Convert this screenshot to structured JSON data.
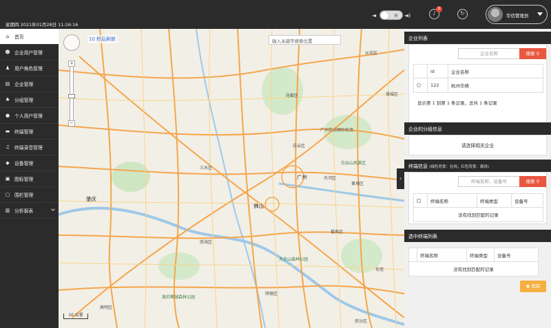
{
  "header": {
    "datetime": "星期四 2021年01月28日 11:26:16",
    "toggle_label": "关",
    "notification_count": "0",
    "username": "华信管理员"
  },
  "sidebar": {
    "items": [
      {
        "label": "首页",
        "icon": "home-icon"
      },
      {
        "label": "企业用户管理",
        "icon": "users-icon"
      },
      {
        "label": "用户角色管理",
        "icon": "user-role-icon"
      },
      {
        "label": "企业管理",
        "icon": "building-icon"
      },
      {
        "label": "分组管理",
        "icon": "sitemap-icon"
      },
      {
        "label": "个人用户管理",
        "icon": "user-icon"
      },
      {
        "label": "终端管理",
        "icon": "terminal-icon"
      },
      {
        "label": "终端录音管理",
        "icon": "music-icon"
      },
      {
        "label": "设备管理",
        "icon": "tag-icon"
      },
      {
        "label": "图标管理",
        "icon": "image-icon"
      },
      {
        "label": "围栏管理",
        "icon": "fence-icon"
      },
      {
        "label": "分析报表",
        "icon": "report-icon"
      }
    ]
  },
  "map": {
    "refresh_text": "10 秒后刷新",
    "search_placeholder": "输入关键字搜索位置",
    "scale_text": "10 公里",
    "labels": {
      "guangzhou": "广州",
      "foshan": "佛山",
      "zhaoqing": "肇庆",
      "baiyun": "白云区",
      "tianhe": "天河区",
      "huangpu": "黄埔区",
      "panyu": "番禺区",
      "nanhai": "南海区",
      "shunde": "顺德区",
      "conghua": "从化区",
      "zengcheng": "增城区",
      "dongguan": "东莞",
      "sanshui": "三水区",
      "huadu": "花都区",
      "airport": "广州白云国际机场",
      "nansha": "南沙区",
      "gaoming": "高明区",
      "park1": "白云山风景区",
      "park2": "大夫山森林公园",
      "park3": "美的鹭湖森林公园"
    }
  },
  "enterprise_list": {
    "title": "企业列表",
    "search_placeholder": "企业名称",
    "search_button": "搜索",
    "columns": [
      "id",
      "企业名称"
    ],
    "rows": [
      {
        "id": "122",
        "name": "杭州华络"
      }
    ],
    "page_info": "显示第 1 到第 1 条记录，总共 1 条记录"
  },
  "group_info": {
    "title": "企业的分组信息",
    "message": "请选择相关企业"
  },
  "terminal_info": {
    "title": "终端信息",
    "subtitle": "(绿色背景：在线；红色背景：离线)",
    "search_placeholder": "终端名称、设备号",
    "search_button": "搜索",
    "columns": [
      "终端名称",
      "终端类型",
      "设备号"
    ],
    "empty": "没有找到匹配的记录"
  },
  "selected_list": {
    "title": "选中终端列表",
    "columns": [
      "终端名称",
      "终端类型",
      "设备号"
    ],
    "empty": "没有找到匹配的记录",
    "track_button": "追踪"
  }
}
